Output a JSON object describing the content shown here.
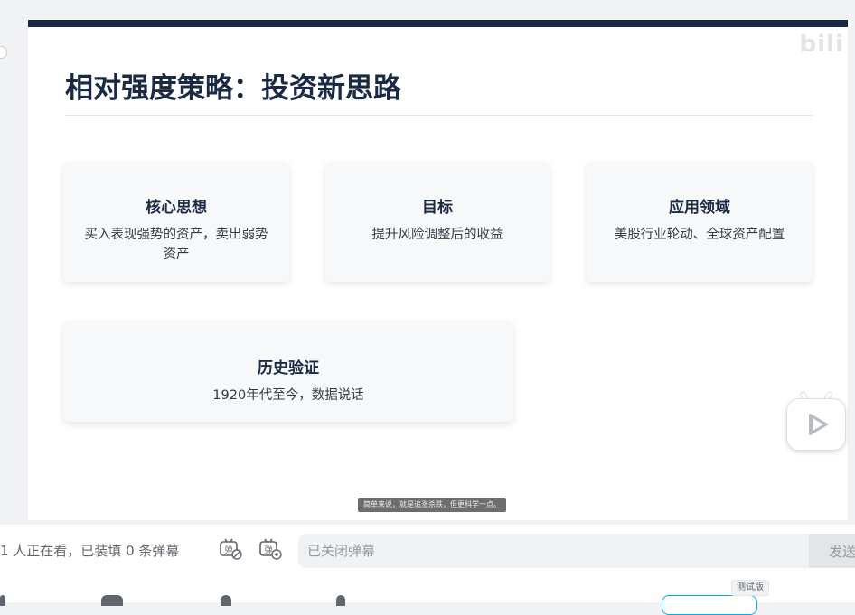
{
  "slide": {
    "title": "相对强度策略：投资新思路",
    "watermark": "bili",
    "cards": [
      {
        "heading": "核心思想",
        "body": "买入表现强势的资产，卖出弱势资产"
      },
      {
        "heading": "目标",
        "body": "提升风险调整后的收益"
      },
      {
        "heading": "应用领域",
        "body": "美股行业轮动、全球资产配置"
      },
      {
        "heading": "历史验证",
        "body": "1920年代至今，数据说话"
      }
    ]
  },
  "subtitle_text": "简单来说，就是追涨杀跌，但更科学一点。",
  "danmaku": {
    "viewers_text": "1 人正在看，已装填 0 条弹幕",
    "input_placeholder": "已关闭弹幕",
    "send_label": "发送",
    "toggle_icon_glyph": "弹",
    "settings_icon_glyph": "弹"
  },
  "beta_badge": "测试版",
  "colors": {
    "slide_title": "#1b2a44",
    "topbar": "#1b2a44",
    "accent": "#00aeec"
  }
}
